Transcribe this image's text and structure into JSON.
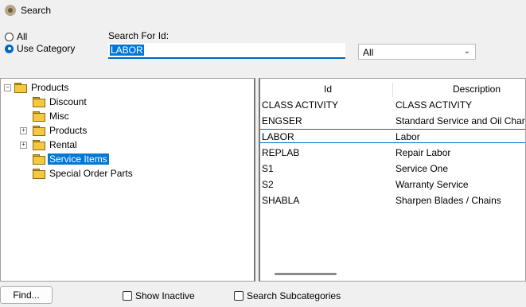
{
  "window": {
    "title": "Search",
    "icon": "app-icon"
  },
  "mode": {
    "options": [
      {
        "label": "All",
        "selected": false
      },
      {
        "label": "Use Category",
        "selected": true
      }
    ]
  },
  "search": {
    "label": "Search For Id:",
    "value": "LABOR"
  },
  "filter": {
    "value": "All"
  },
  "tree": {
    "root": "Products",
    "children": [
      {
        "label": "Discount",
        "expandable": false
      },
      {
        "label": "Misc",
        "expandable": false
      },
      {
        "label": "Products",
        "expandable": true
      },
      {
        "label": "Rental",
        "expandable": true
      },
      {
        "label": "Service Items",
        "expandable": false,
        "selected": true
      },
      {
        "label": "Special Order Parts",
        "expandable": false
      }
    ]
  },
  "list": {
    "columns": [
      "Id",
      "Description"
    ],
    "rows": [
      {
        "id": "CLASS ACTIVITY",
        "description": "CLASS ACTIVITY"
      },
      {
        "id": "ENGSER",
        "description": "Standard Service and Oil Change"
      },
      {
        "id": "LABOR",
        "description": "Labor",
        "selected": true
      },
      {
        "id": "REPLAB",
        "description": "Repair Labor"
      },
      {
        "id": "S1",
        "description": "Service One"
      },
      {
        "id": "S2",
        "description": "Warranty Service"
      },
      {
        "id": "SHABLA",
        "description": "Sharpen Blades / Chains"
      }
    ]
  },
  "footer": {
    "find_label": "Find...",
    "show_inactive_label": "Show Inactive",
    "search_subcategories_label": "Search Subcategories"
  }
}
